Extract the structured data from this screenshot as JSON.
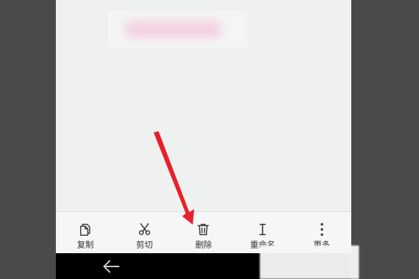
{
  "toolbar": {
    "items": [
      {
        "label": "复制",
        "icon": "copy-icon"
      },
      {
        "label": "剪切",
        "icon": "scissors-icon"
      },
      {
        "label": "删除",
        "icon": "trash-icon"
      },
      {
        "label": "重命名",
        "icon": "text-cursor-icon"
      },
      {
        "label": "更多",
        "icon": "more-vertical-icon"
      }
    ]
  },
  "navbar": {
    "back_icon": "back-arrow-icon"
  },
  "annotation": {
    "arrow_color": "#e8202a",
    "points_to": "删除"
  },
  "colors": {
    "background": "#4a4a4a",
    "screen": "#eef1f0",
    "toolbar": "#f5f6f5",
    "navbar": "#000000"
  }
}
